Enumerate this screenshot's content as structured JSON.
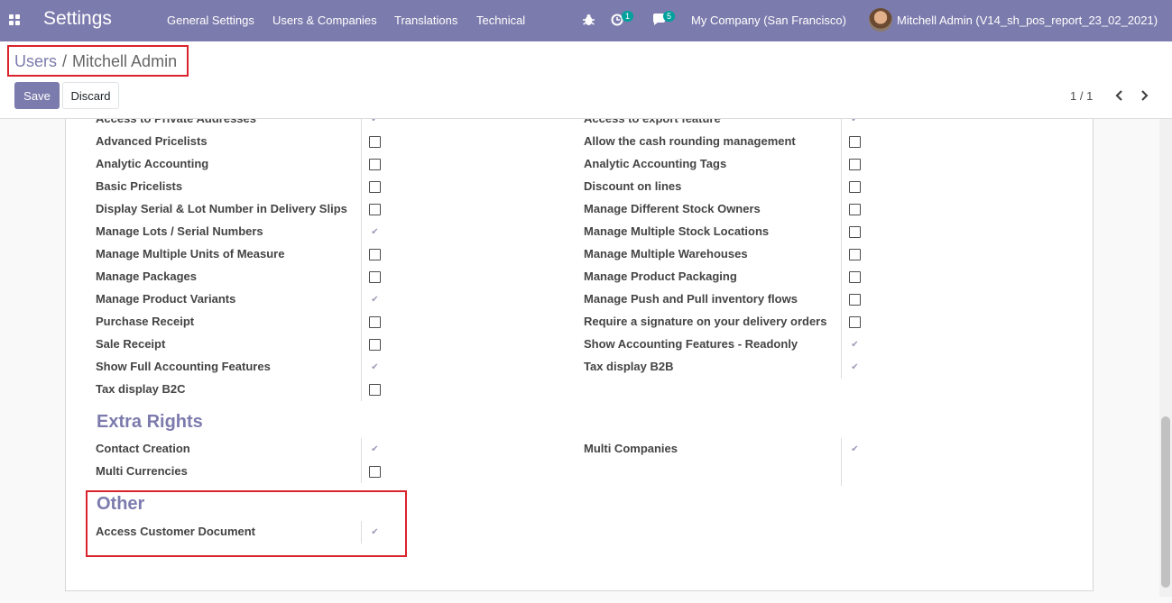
{
  "navbar": {
    "app_title": "Settings",
    "menu": [
      "General Settings",
      "Users & Companies",
      "Translations",
      "Technical"
    ],
    "activity_count": "1",
    "messages_count": "5",
    "company": "My Company (San Francisco)",
    "user": "Mitchell Admin (V14_sh_pos_report_23_02_2021)"
  },
  "breadcrumb": {
    "parent": "Users",
    "separator": "/",
    "current": "Mitchell Admin"
  },
  "buttons": {
    "save": "Save",
    "discard": "Discard"
  },
  "pager": {
    "value": "1 / 1"
  },
  "technical_rows": [
    {
      "left": "Access to Private Addresses",
      "left_checked": true,
      "right": "Access to export feature",
      "right_checked": true
    },
    {
      "left": "Advanced Pricelists",
      "left_checked": false,
      "right": "Allow the cash rounding management",
      "right_checked": false
    },
    {
      "left": "Analytic Accounting",
      "left_checked": false,
      "right": "Analytic Accounting Tags",
      "right_checked": false
    },
    {
      "left": "Basic Pricelists",
      "left_checked": false,
      "right": "Discount on lines",
      "right_checked": false
    },
    {
      "left": "Display Serial & Lot Number in Delivery Slips",
      "left_checked": false,
      "right": "Manage Different Stock Owners",
      "right_checked": false
    },
    {
      "left": "Manage Lots / Serial Numbers",
      "left_checked": true,
      "right": "Manage Multiple Stock Locations",
      "right_checked": false
    },
    {
      "left": "Manage Multiple Units of Measure",
      "left_checked": false,
      "right": "Manage Multiple Warehouses",
      "right_checked": false
    },
    {
      "left": "Manage Packages",
      "left_checked": false,
      "right": "Manage Product Packaging",
      "right_checked": false
    },
    {
      "left": "Manage Product Variants",
      "left_checked": true,
      "right": "Manage Push and Pull inventory flows",
      "right_checked": false
    },
    {
      "left": "Purchase Receipt",
      "left_checked": false,
      "right": "Require a signature on your delivery orders",
      "right_checked": false
    },
    {
      "left": "Sale Receipt",
      "left_checked": false,
      "right": "Show Accounting Features - Readonly",
      "right_checked": true
    },
    {
      "left": "Show Full Accounting Features",
      "left_checked": true,
      "right": "Tax display B2B",
      "right_checked": true
    },
    {
      "left": "Tax display B2C",
      "left_checked": false,
      "right": null,
      "right_checked": null
    }
  ],
  "extra_rights": {
    "title": "Extra Rights",
    "rows": [
      {
        "left": "Contact Creation",
        "left_checked": true,
        "right": "Multi Companies",
        "right_checked": true
      },
      {
        "left": "Multi Currencies",
        "left_checked": false,
        "right": null,
        "right_checked": null
      }
    ]
  },
  "other": {
    "title": "Other",
    "rows": [
      {
        "left": "Access Customer Document",
        "left_checked": true
      }
    ]
  },
  "colors": {
    "primary": "#7c7bad",
    "highlight": "#d9232d"
  }
}
